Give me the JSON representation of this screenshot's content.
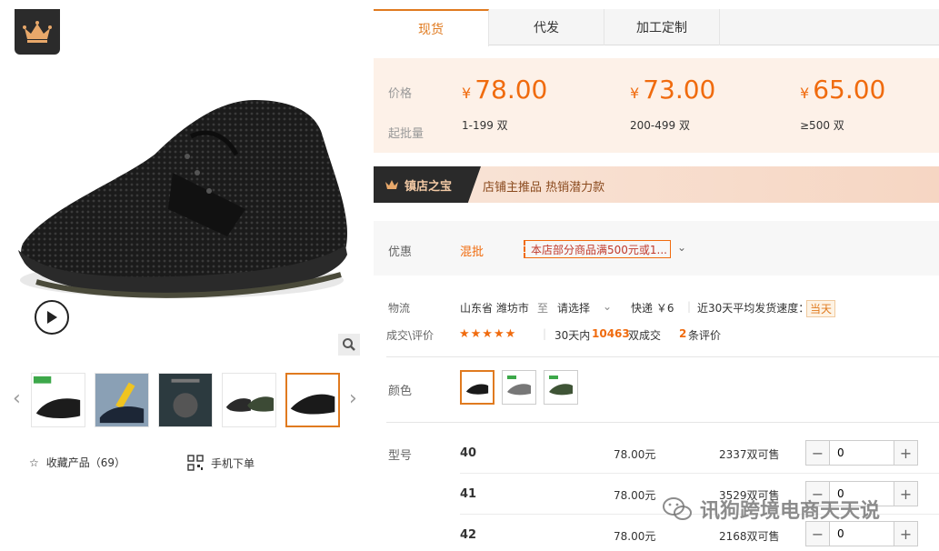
{
  "gallery": {
    "play_icon": "play-icon",
    "zoom_icon": "magnify-icon",
    "thumbnails": [
      {
        "name": "thumb-1"
      },
      {
        "name": "thumb-2"
      },
      {
        "name": "thumb-3"
      },
      {
        "name": "thumb-4"
      },
      {
        "name": "thumb-5",
        "active": true
      }
    ],
    "favorite_label": "收藏产品（69）",
    "mobile_order_label": "手机下单"
  },
  "tabs": [
    {
      "label": "现货",
      "active": true
    },
    {
      "label": "代发"
    },
    {
      "label": "加工定制"
    }
  ],
  "pricing": {
    "price_label": "价格",
    "moq_label": "起批量",
    "currency": "¥",
    "tiers": [
      {
        "price": "78.00",
        "qty": "1-199 双"
      },
      {
        "price": "73.00",
        "qty": "200-499 双"
      },
      {
        "price": "65.00",
        "qty": "≥500 双"
      }
    ]
  },
  "promo": {
    "badge": "镇店之宝",
    "text": "店铺主推品  热销潜力款"
  },
  "discount": {
    "label": "优惠",
    "tag": "混批",
    "coupon": "本店部分商品满500元或1..."
  },
  "logistics": {
    "label": "物流",
    "from": "山东省 潍坊市",
    "to_word": "至",
    "dest": "请选择",
    "express": "快递 ￥6",
    "speed_label": "近30天平均发货速度：",
    "speed_value": "当天"
  },
  "reviews": {
    "label": "成交\\评价",
    "stars": "★★★★★",
    "sales_prefix": "30天内",
    "sales_count": "10463",
    "sales_suffix": "双成交",
    "review_count": "2",
    "review_suffix": "条评价"
  },
  "colors": {
    "label": "颜色",
    "swatches": [
      {
        "name": "black",
        "active": true
      },
      {
        "name": "grey"
      },
      {
        "name": "green"
      }
    ]
  },
  "sku": {
    "label": "型号",
    "rows": [
      {
        "size": "40",
        "price": "78.00元",
        "stock": "2337双可售",
        "qty": "0"
      },
      {
        "size": "41",
        "price": "78.00元",
        "stock": "3529双可售",
        "qty": "0"
      },
      {
        "size": "42",
        "price": "78.00元",
        "stock": "2168双可售",
        "qty": "0"
      }
    ]
  },
  "watermark": "讯狗跨境电商天天说",
  "colors_theme": {
    "accent": "#e07a1f",
    "price": "#f06b0e",
    "badge_bg": "#2a2a2a"
  }
}
